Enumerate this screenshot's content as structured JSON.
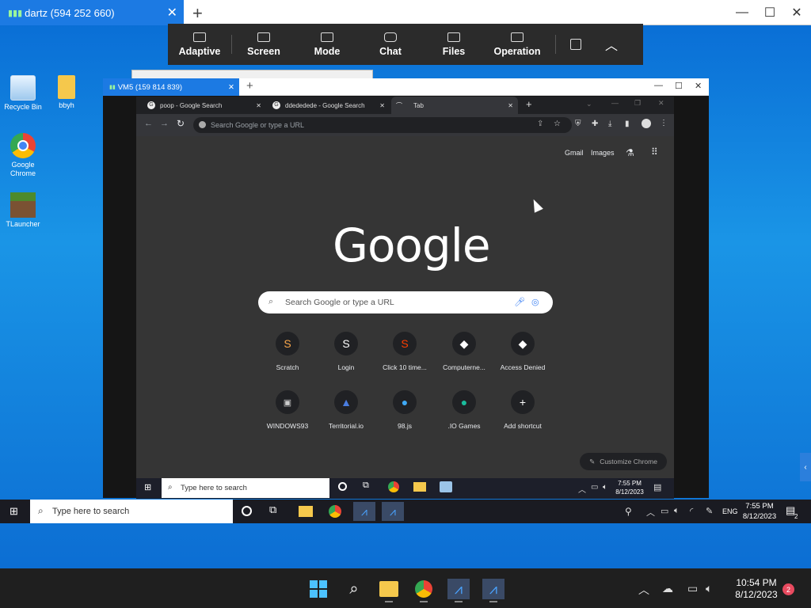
{
  "outer": {
    "session_title": "dartz (594 252 660)",
    "new_tab": "+",
    "minimize": "—",
    "maximize": "☐",
    "close": "✕"
  },
  "toolbar": {
    "items": [
      {
        "label": "Adaptive"
      },
      {
        "label": "Screen"
      },
      {
        "label": "Mode"
      },
      {
        "label": "Chat"
      },
      {
        "label": "Files"
      },
      {
        "label": "Operation"
      }
    ]
  },
  "desktop": {
    "icons": [
      {
        "label": "Recycle Bin"
      },
      {
        "label": "bbyh"
      },
      {
        "label": "Google Chrome"
      },
      {
        "label": "TLauncher"
      }
    ]
  },
  "inner_window": {
    "title": "VM5 (159 814 839)",
    "new_tab": "+"
  },
  "chrome": {
    "tabs": [
      {
        "title": "poop - Google Search"
      },
      {
        "title": "ddededede - Google Search"
      },
      {
        "title": "Tab"
      }
    ],
    "omnibox_placeholder": "Search Google or type a URL",
    "top_links": [
      "Gmail",
      "Images"
    ],
    "logo": "Google",
    "search_placeholder": "Search Google or type a URL",
    "shortcuts_row1": [
      {
        "label": "Scratch",
        "glyph": "S"
      },
      {
        "label": "Login",
        "glyph": "S"
      },
      {
        "label": "Click 10 time...",
        "glyph": "S"
      },
      {
        "label": "Computerne...",
        "glyph": "◆"
      },
      {
        "label": "Access Denied",
        "glyph": "◆"
      }
    ],
    "shortcuts_row2": [
      {
        "label": "WINDOWS93",
        "glyph": "▣"
      },
      {
        "label": "Territorial.io",
        "glyph": "▲"
      },
      {
        "label": "98.js",
        "glyph": "●"
      },
      {
        "label": ".IO Games",
        "glyph": "●"
      },
      {
        "label": "Add shortcut",
        "glyph": "+"
      }
    ],
    "customize": "Customize Chrome"
  },
  "vm_taskbar": {
    "search_placeholder": "Type here to search",
    "time": "7:55 PM",
    "date": "8/12/2023"
  },
  "remote_taskbar": {
    "search_placeholder": "Type here to search",
    "lang": "ENG",
    "time": "7:55 PM",
    "date": "8/12/2023",
    "notif_count": "2"
  },
  "local_taskbar": {
    "time": "10:54 PM",
    "date": "8/12/2023",
    "notif_count": "2"
  }
}
